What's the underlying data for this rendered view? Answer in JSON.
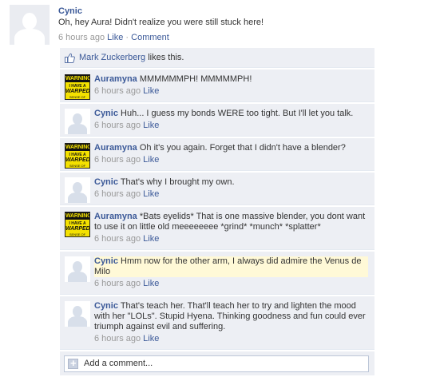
{
  "post": {
    "author": "Cynic",
    "text": "Oh, hey Aura! Didn't realize you were still stuck here!",
    "time": "6 hours ago",
    "like_label": "Like",
    "separator": "·",
    "comment_label": "Comment"
  },
  "likes": {
    "name": "Mark Zuckerberg",
    "suffix": "likes this."
  },
  "comments": [
    {
      "author": "Auramyna",
      "avatar": "warning",
      "text": "MMMMMMPH! MMMMMPH!",
      "time": "6 hours ago",
      "like": "Like"
    },
    {
      "author": "Cynic",
      "avatar": "default",
      "text": "Huh... I guess my bonds WERE too tight. But I'll let you talk.",
      "time": "6 hours ago",
      "like": "Like"
    },
    {
      "author": "Auramyna",
      "avatar": "warning",
      "text": "Oh it's you again. Forget that I didn't have a blender?",
      "time": "6 hours ago",
      "like": "Like"
    },
    {
      "author": "Cynic",
      "avatar": "default",
      "text": "That's why I brought my own.",
      "time": "6 hours ago",
      "like": "Like"
    },
    {
      "author": "Auramyna",
      "avatar": "warning",
      "text": "*Bats eyelids* That is one massive blender, you dont want to use it on little old meeeeeeee *grind* *munch* *splatter*",
      "time": "6 hours ago",
      "like": "Like"
    },
    {
      "author": "Cynic",
      "avatar": "default",
      "highlight": true,
      "text": "Hmm now for the other arm, I always did admire the Venus de Milo",
      "time": "6 hours ago",
      "like": "Like"
    },
    {
      "author": "Cynic",
      "avatar": "default",
      "text": "That's teach her. That'll teach her to try and lighten the mood with her \"LOLs\". Stupid Hyena. Thinking goodness and fun could ever triumph against evil and suffering.",
      "time": "6 hours ago",
      "like": "Like"
    }
  ],
  "warning_avatar": {
    "top": "WARNING",
    "mid": "I HAVE A",
    "big": "WARPED",
    "bottom": "SENSE OF HUMOUR"
  },
  "add_comment": {
    "placeholder": "Add a comment..."
  }
}
